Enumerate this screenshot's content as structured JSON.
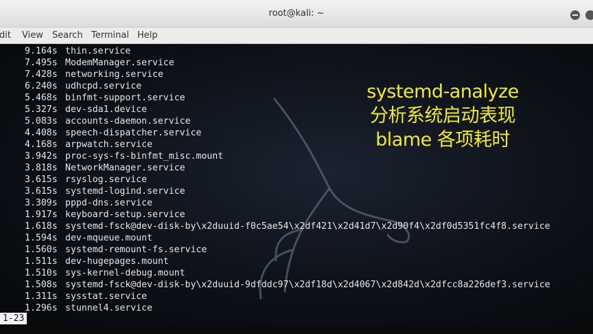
{
  "window": {
    "title": "root@kali: ~"
  },
  "menu": [
    "Edit",
    "View",
    "Search",
    "Terminal",
    "Help"
  ],
  "menu_display": [
    "dit",
    "View",
    "Search",
    "Terminal",
    "Help"
  ],
  "caption": {
    "line1": "systemd-analyze",
    "line2": "分析系统启动表现",
    "line3": "blame 各项耗时"
  },
  "blame": [
    {
      "time": "9.164s",
      "unit": "thin.service"
    },
    {
      "time": "7.495s",
      "unit": "ModemManager.service"
    },
    {
      "time": "7.428s",
      "unit": "networking.service"
    },
    {
      "time": "6.240s",
      "unit": "udhcpd.service"
    },
    {
      "time": "5.468s",
      "unit": "binfmt-support.service"
    },
    {
      "time": "5.327s",
      "unit": "dev-sda1.device"
    },
    {
      "time": "5.083s",
      "unit": "accounts-daemon.service"
    },
    {
      "time": "4.408s",
      "unit": "speech-dispatcher.service"
    },
    {
      "time": "4.168s",
      "unit": "arpwatch.service"
    },
    {
      "time": "3.942s",
      "unit": "proc-sys-fs-binfmt_misc.mount"
    },
    {
      "time": "3.818s",
      "unit": "NetworkManager.service"
    },
    {
      "time": "3.615s",
      "unit": "rsyslog.service"
    },
    {
      "time": "3.615s",
      "unit": "systemd-logind.service"
    },
    {
      "time": "3.309s",
      "unit": "pppd-dns.service"
    },
    {
      "time": "1.917s",
      "unit": "keyboard-setup.service"
    },
    {
      "time": "1.618s",
      "unit": "systemd-fsck@dev-disk-by\\x2duuid-f0c5ae54\\x2df421\\x2d41d7\\x2d90f4\\x2df0d5351fc4f8.service"
    },
    {
      "time": "1.594s",
      "unit": "dev-mqueue.mount"
    },
    {
      "time": "1.560s",
      "unit": "systemd-remount-fs.service"
    },
    {
      "time": "1.511s",
      "unit": "dev-hugepages.mount"
    },
    {
      "time": "1.510s",
      "unit": "sys-kernel-debug.mount"
    },
    {
      "time": "1.508s",
      "unit": "systemd-fsck@dev-disk-by\\x2duuid-9dfddc97\\x2df18d\\x2d4067\\x2d842d\\x2dfcc8a226def3.service"
    },
    {
      "time": "1.311s",
      "unit": "sysstat.service"
    },
    {
      "time": "1.296s",
      "unit": "stunnel4.service"
    }
  ],
  "status": "1-23"
}
